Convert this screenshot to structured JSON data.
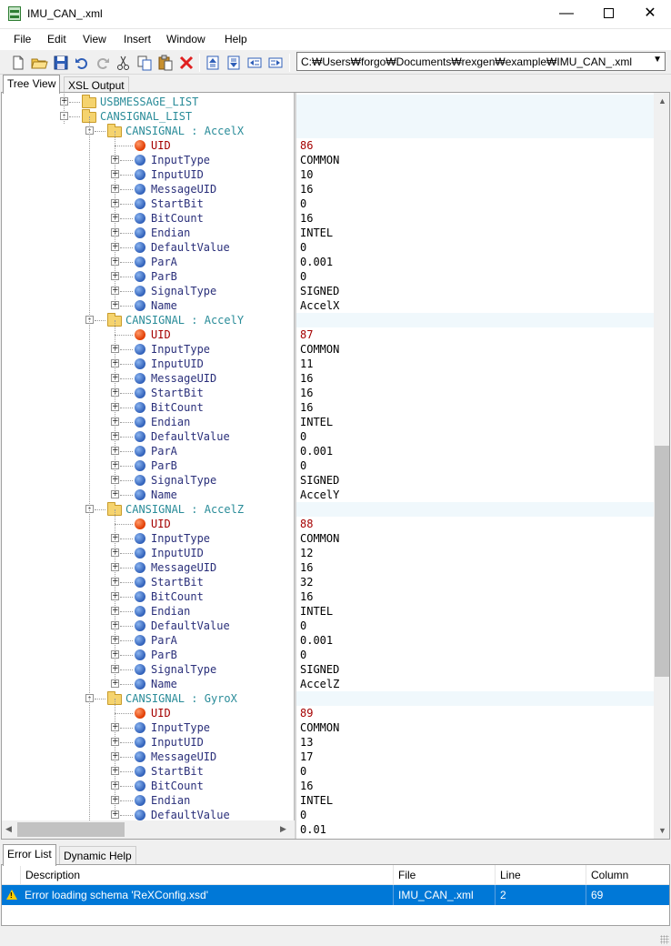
{
  "window": {
    "title": "IMU_CAN_.xml",
    "minimize_glyph": "—",
    "close_glyph": "✕"
  },
  "menu": [
    "File",
    "Edit",
    "View",
    "Insert",
    "Window",
    "Help"
  ],
  "toolbar": {
    "path": "C:₩Users₩forgo₩Documents₩rexgen₩example₩IMU_CAN_.xml"
  },
  "tabs": [
    "Tree View",
    "XSL Output"
  ],
  "tree": {
    "top_nodes": [
      {
        "label": "USBMESSAGE_LIST"
      },
      {
        "label": "CANSIGNAL_LIST"
      }
    ],
    "signal_prefix": "CANSIGNAL",
    "signals": [
      {
        "name": "AccelX",
        "fields": [
          {
            "key": "UID",
            "value": "86"
          },
          {
            "key": "InputType",
            "value": "COMMON"
          },
          {
            "key": "InputUID",
            "value": "10"
          },
          {
            "key": "MessageUID",
            "value": "16"
          },
          {
            "key": "StartBit",
            "value": "0"
          },
          {
            "key": "BitCount",
            "value": "16"
          },
          {
            "key": "Endian",
            "value": "INTEL"
          },
          {
            "key": "DefaultValue",
            "value": "0"
          },
          {
            "key": "ParA",
            "value": "0.001"
          },
          {
            "key": "ParB",
            "value": "0"
          },
          {
            "key": "SignalType",
            "value": "SIGNED"
          },
          {
            "key": "Name",
            "value": "AccelX"
          }
        ]
      },
      {
        "name": "AccelY",
        "fields": [
          {
            "key": "UID",
            "value": "87"
          },
          {
            "key": "InputType",
            "value": "COMMON"
          },
          {
            "key": "InputUID",
            "value": "11"
          },
          {
            "key": "MessageUID",
            "value": "16"
          },
          {
            "key": "StartBit",
            "value": "16"
          },
          {
            "key": "BitCount",
            "value": "16"
          },
          {
            "key": "Endian",
            "value": "INTEL"
          },
          {
            "key": "DefaultValue",
            "value": "0"
          },
          {
            "key": "ParA",
            "value": "0.001"
          },
          {
            "key": "ParB",
            "value": "0"
          },
          {
            "key": "SignalType",
            "value": "SIGNED"
          },
          {
            "key": "Name",
            "value": "AccelY"
          }
        ]
      },
      {
        "name": "AccelZ",
        "fields": [
          {
            "key": "UID",
            "value": "88"
          },
          {
            "key": "InputType",
            "value": "COMMON"
          },
          {
            "key": "InputUID",
            "value": "12"
          },
          {
            "key": "MessageUID",
            "value": "16"
          },
          {
            "key": "StartBit",
            "value": "32"
          },
          {
            "key": "BitCount",
            "value": "16"
          },
          {
            "key": "Endian",
            "value": "INTEL"
          },
          {
            "key": "DefaultValue",
            "value": "0"
          },
          {
            "key": "ParA",
            "value": "0.001"
          },
          {
            "key": "ParB",
            "value": "0"
          },
          {
            "key": "SignalType",
            "value": "SIGNED"
          },
          {
            "key": "Name",
            "value": "AccelZ"
          }
        ]
      },
      {
        "name": "GyroX",
        "fields": [
          {
            "key": "UID",
            "value": "89"
          },
          {
            "key": "InputType",
            "value": "COMMON"
          },
          {
            "key": "InputUID",
            "value": "13"
          },
          {
            "key": "MessageUID",
            "value": "17"
          },
          {
            "key": "StartBit",
            "value": "0"
          },
          {
            "key": "BitCount",
            "value": "16"
          },
          {
            "key": "Endian",
            "value": "INTEL"
          },
          {
            "key": "DefaultValue",
            "value": "0"
          }
        ],
        "next_value": "0.01"
      }
    ]
  },
  "bottom_tabs": [
    "Error List",
    "Dynamic Help"
  ],
  "error_list": {
    "columns": [
      "Description",
      "File",
      "Line",
      "Column"
    ],
    "rows": [
      {
        "description": "Error loading schema 'ReXConfig.xsd'",
        "file": "IMU_CAN_.xml",
        "line": "2",
        "column": "69",
        "severity": "warning"
      }
    ]
  },
  "colors": {
    "selection": "#0078d7",
    "node_teal": "#2a8c99",
    "uid_red": "#a50000"
  }
}
